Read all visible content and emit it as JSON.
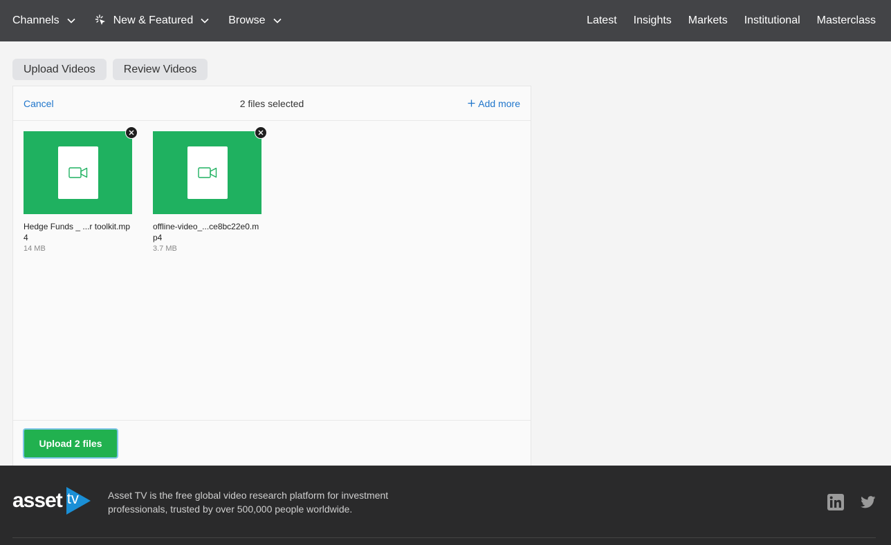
{
  "nav": {
    "left": [
      {
        "label": "Channels",
        "icon": "chevron-down-icon"
      },
      {
        "label": "New & Featured",
        "icon": "sparkle-icon"
      },
      {
        "label": "Browse",
        "icon": "chevron-down-icon"
      }
    ],
    "right": [
      "Latest",
      "Insights",
      "Markets",
      "Institutional",
      "Masterclass"
    ]
  },
  "tabs": [
    "Upload Videos",
    "Review Videos"
  ],
  "uploader": {
    "cancel_label": "Cancel",
    "status": "2 files selected",
    "add_more_label": "Add more",
    "files": [
      {
        "name": "Hedge Funds _ ...r toolkit.mp4",
        "size": "14 MB"
      },
      {
        "name": "offline-video_...ce8bc22e0.mp4",
        "size": "3.7 MB"
      }
    ],
    "upload_label": "Upload 2 files"
  },
  "footer": {
    "logo_word": "asset",
    "logo_tv": "tv",
    "description": "Asset TV is the free global video research platform for investment professionals, trusted by over 500,000 people worldwide."
  },
  "colors": {
    "nav_bg": "#434447",
    "thumb_green": "#1fb160",
    "upload_green": "#21b14f",
    "link_blue": "#1f75cb",
    "footer_bg": "#2a2a2b",
    "logo_blue": "#1a8fd6"
  }
}
